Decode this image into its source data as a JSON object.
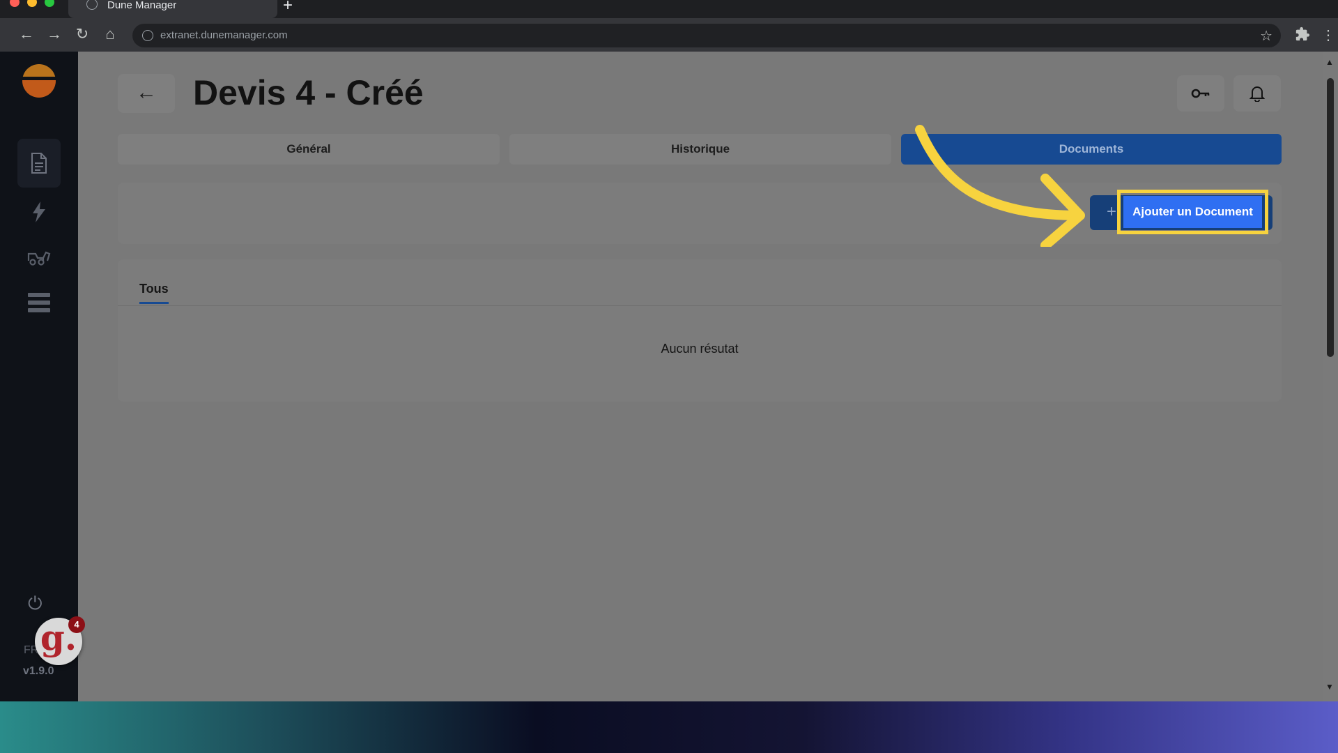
{
  "browser": {
    "tab_title": "Dune Manager",
    "url": "extranet.dunemanager.com"
  },
  "sidebar": {
    "items": [
      {
        "icon": "document-icon",
        "active": true
      },
      {
        "icon": "bolt-icon",
        "active": false
      },
      {
        "icon": "truck-icon",
        "active": false
      },
      {
        "icon": "list-icon",
        "active": false
      }
    ],
    "lang": "FR",
    "version": "v1.9.0",
    "chat_badge": "4",
    "chat_logo": "g."
  },
  "header": {
    "title": "Devis 4 - Créé"
  },
  "tabs": [
    {
      "label": "Général"
    },
    {
      "label": "Historique"
    },
    {
      "label": "Documents",
      "active": true
    }
  ],
  "actions": {
    "add_document_label": "Ajouter un Document"
  },
  "documents": {
    "filter_tab": "Tous",
    "empty_text": "Aucun résutat"
  },
  "colors": {
    "accent": "#174a92",
    "highlight": "#f7d33f",
    "primary_button": "#2f6ff2"
  }
}
